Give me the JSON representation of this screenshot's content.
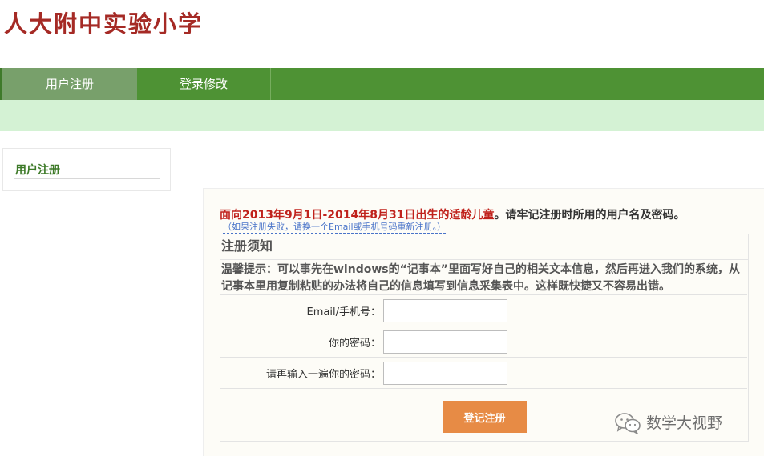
{
  "site": {
    "title": "人大附中实验小学"
  },
  "nav": {
    "tabs": [
      {
        "label": "用户注册"
      },
      {
        "label": "登录修改"
      }
    ]
  },
  "sidebar": {
    "item_label": "用户注册"
  },
  "notice": {
    "highlight": "面向2013年9月1日-2014年8月31日出生的适龄儿童",
    "rest": "。请牢记注册时所用的用户名及密码。",
    "retry_hint": "（如果注册失败，请换一个Email或手机号码重新注册。）"
  },
  "rules": {
    "title": "注册须知",
    "text": "温馨提示：可以事先在windows的“记事本”里面写好自己的相关文本信息，然后再进入我们的系统，从记事本里用复制粘贴的办法将自己的信息填写到信息采集表中。这样既快捷又不容易出错。"
  },
  "form": {
    "email_label": "Email/手机号：",
    "email_value": "",
    "password_label": "你的密码：",
    "password_value": "",
    "confirm_label": "请再输入一遍你的密码：",
    "confirm_value": "",
    "submit_label": "登记注册"
  },
  "watermark": {
    "text": "数学大视野",
    "icon": "wechat-icon"
  },
  "colors": {
    "title": "#a52a25",
    "nav_bg": "#4e9234",
    "nav_active": "#78a06b",
    "subbar": "#d4f2d4",
    "notice_red": "#c0221c",
    "submit": "#e78b45"
  }
}
